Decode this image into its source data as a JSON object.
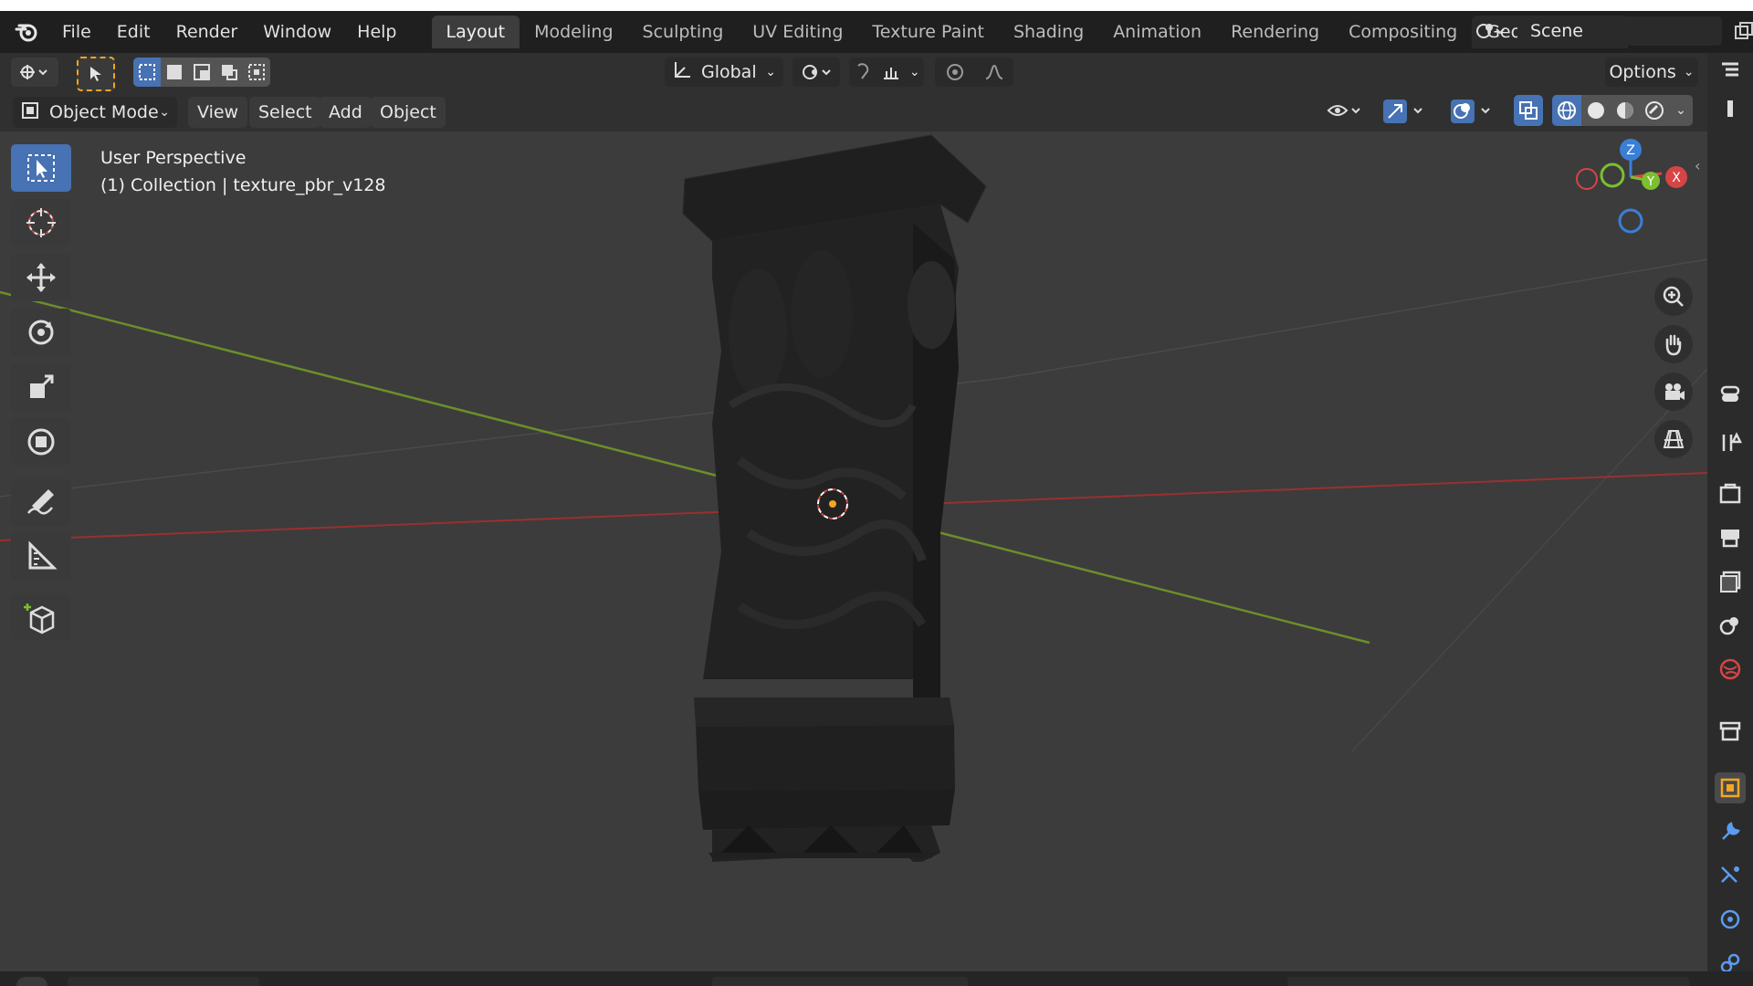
{
  "app": {
    "name": "Blender"
  },
  "menu": [
    "File",
    "Edit",
    "Render",
    "Window",
    "Help"
  ],
  "workspaces": [
    {
      "label": "Layout",
      "active": true
    },
    {
      "label": "Modeling",
      "active": false
    },
    {
      "label": "Sculpting",
      "active": false
    },
    {
      "label": "UV Editing",
      "active": false
    },
    {
      "label": "Texture Paint",
      "active": false
    },
    {
      "label": "Shading",
      "active": false
    },
    {
      "label": "Animation",
      "active": false
    },
    {
      "label": "Rendering",
      "active": false
    },
    {
      "label": "Compositing",
      "active": false
    },
    {
      "label": "Geometry Nod",
      "active": false
    }
  ],
  "scene": {
    "value": "Scene"
  },
  "header": {
    "transform_orientation": "Global",
    "options_label": "Options",
    "mode": "Object Mode",
    "view_menu": [
      "View",
      "Select",
      "Add",
      "Object"
    ]
  },
  "viewport": {
    "perspective": "User Perspective",
    "collection": "(1) Collection | texture_pbr_v128"
  },
  "gizmo": {
    "x": "X",
    "y": "Y",
    "z": "Z"
  },
  "colors": {
    "accent": "#4772b3",
    "x_axis": "#d64545",
    "y_axis": "#7cbf2f",
    "z_axis": "#3a7fd6",
    "active_object": "#f5a623"
  },
  "tools": [
    "select-box",
    "cursor",
    "move",
    "rotate",
    "scale",
    "transform",
    "annotate",
    "measure",
    "add-cube"
  ]
}
